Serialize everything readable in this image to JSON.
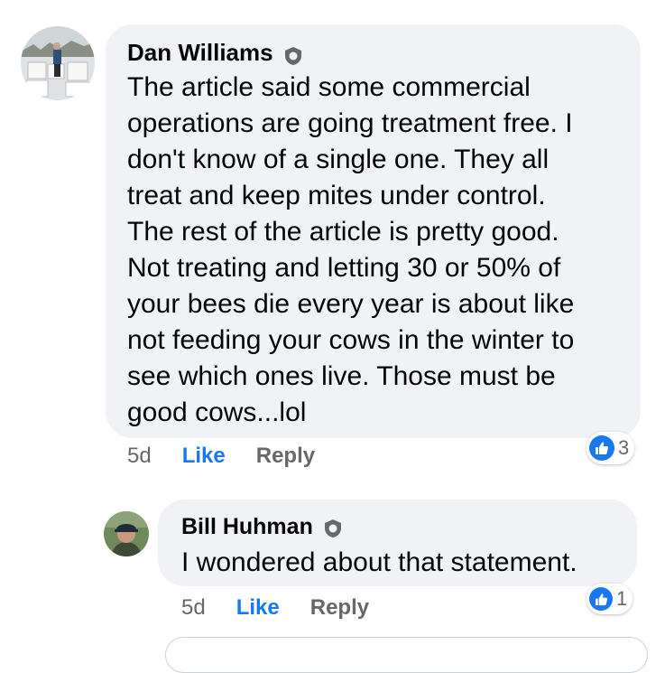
{
  "comments": [
    {
      "author": "Dan Williams",
      "text": "The article said some commercial\noperations are going treatment free. I\ndon't know of a single one. They all\ntreat and keep mites under control.\nThe rest of the article is pretty good.\nNot treating and letting 30 or 50% of\nyour bees die every year is about like\nnot feeding your cows in the winter to\nsee which ones live. Those must be\ngood cows...lol",
      "time": "5d",
      "like_label": "Like",
      "reply_label": "Reply",
      "reaction_count": "3"
    },
    {
      "author": "Bill Huhman",
      "text": "I wondered about that statement.",
      "time": "5d",
      "like_label": "Like",
      "reply_label": "Reply",
      "reaction_count": "1"
    }
  ],
  "colors": {
    "bubble": "#f0f2f5",
    "like_blue": "#1877f2",
    "meta_gray": "#65676b"
  },
  "icons": [
    "verified-shield-icon",
    "thumbs-up-icon"
  ]
}
